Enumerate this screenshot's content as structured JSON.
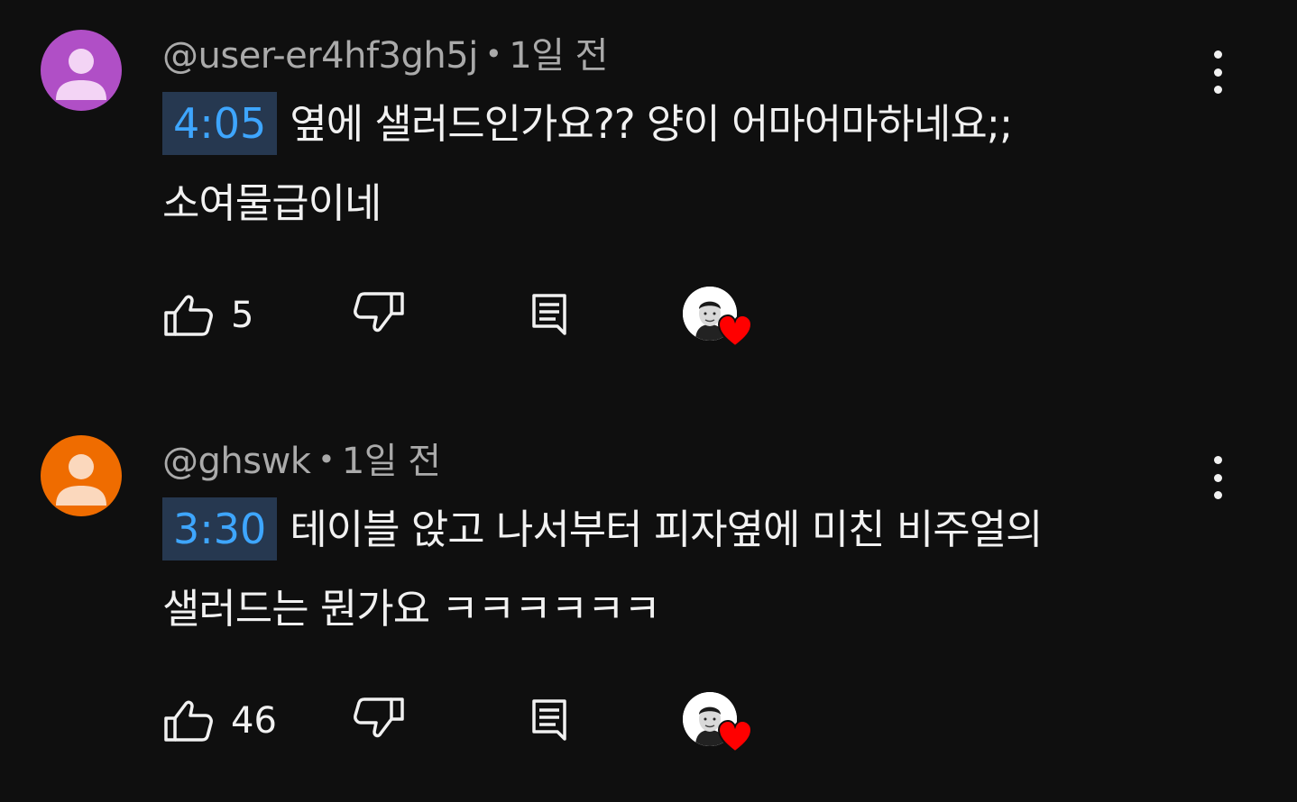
{
  "comments": [
    {
      "author": "@user-er4hf3gh5j",
      "time_ago": "1일 전",
      "avatar_color": "#b04fc6",
      "avatar_icon": "person-silhouette",
      "timestamp_link": "4:05",
      "text_line1": "옆에 샐러드인가요?? 양이 어마어마하네요;;",
      "text_line2": "소여물급이네",
      "like_count": "5",
      "creator_heart": true
    },
    {
      "author": "@ghswk",
      "time_ago": "1일 전",
      "avatar_color": "#ef6c00",
      "avatar_icon": "person-silhouette",
      "timestamp_link": "3:30",
      "text_line1": "테이블 앉고 나서부터 피자옆에 미친 비주얼의",
      "text_line2": "샐러드는 뭔가요 ㅋㅋㅋㅋㅋㅋ",
      "like_count": "46",
      "creator_heart": true
    }
  ],
  "icons": {
    "like": "thumbs-up-icon",
    "dislike": "thumbs-down-icon",
    "reply": "reply-comment-icon",
    "more": "more-vertical-icon",
    "heart": "heart-icon"
  },
  "colors": {
    "background": "#0f0f0f",
    "timestamp_text": "#3ea6ff",
    "timestamp_bg": "#263850",
    "heart": "#ff0000",
    "meta_text": "#aaaaaa"
  },
  "separator": "•"
}
